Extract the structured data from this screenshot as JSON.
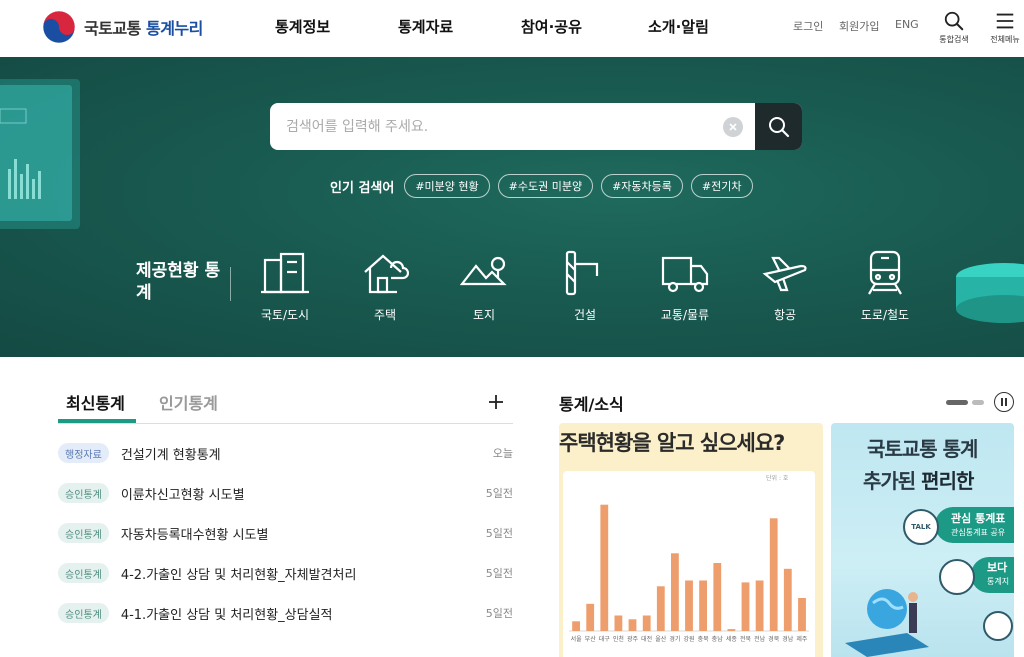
{
  "header": {
    "logo_text_main": "국토교통",
    "logo_text_accent": "통계누리",
    "nav": [
      "통계정보",
      "통계자료",
      "참여·공유",
      "소개·알림"
    ],
    "util": {
      "login": "로그인",
      "signup": "회원가입",
      "lang": "ENG"
    },
    "search_caption": "통합검색",
    "menu_caption": "전체메뉴"
  },
  "hero": {
    "search_placeholder": "검색어를 입력해 주세요.",
    "popular_label": "인기 검색어",
    "popular_tags": [
      "#미분양 현황",
      "#수도권 미분양",
      "#자동차등록",
      "#전기차"
    ],
    "provide_title": "제공현황 통계",
    "categories": [
      "국토/도시",
      "주택",
      "토지",
      "건설",
      "교통/물류",
      "항공",
      "도로/철도"
    ]
  },
  "stats": {
    "tabs": [
      "최신통계",
      "인기통계"
    ],
    "items": [
      {
        "badge": "행정자료",
        "title": "건설기계 현황통계",
        "date": "오늘"
      },
      {
        "badge": "승인통계",
        "title": "이륜차신고현황 시도별",
        "date": "5일전"
      },
      {
        "badge": "승인통계",
        "title": "자동차등록대수현황 시도별",
        "date": "5일전"
      },
      {
        "badge": "승인통계",
        "title": "4-2.가출인 상담 및 처리현황_자체발견처리",
        "date": "5일전"
      },
      {
        "badge": "승인통계",
        "title": "4-1.가출인 상담 및 처리현황_상담실적",
        "date": "5일전"
      }
    ]
  },
  "news": {
    "title": "통계/소식",
    "card1": {
      "heading": "주택현황을 알고 싶으세요?",
      "unit": "단위 : 호",
      "chart_data": {
        "type": "bar",
        "categories": [
          "서울",
          "부산",
          "대구",
          "인천",
          "광주",
          "대전",
          "울산",
          "경기",
          "강원",
          "충북",
          "충남",
          "세종",
          "전북",
          "전남",
          "경북",
          "경남",
          "제주"
        ],
        "values": [
          5,
          14,
          65,
          8,
          6,
          8,
          23,
          40,
          26,
          26,
          35,
          1,
          25,
          26,
          58,
          32,
          17
        ],
        "ylim": [
          0,
          70
        ]
      }
    },
    "card2": {
      "heading_line1": "국토교통 통계",
      "heading_line2a": "추가된 ",
      "heading_line2b": "편리한",
      "item1_title": "관심 통계표",
      "item1_sub": "관심통계표 공유",
      "item2_title": "보다",
      "item2_sub": "통계지",
      "talk": "TALK"
    }
  },
  "colors": {
    "accent": "#1c9a86",
    "hero": "#195a50",
    "brand_blue": "#1a4ea2"
  }
}
